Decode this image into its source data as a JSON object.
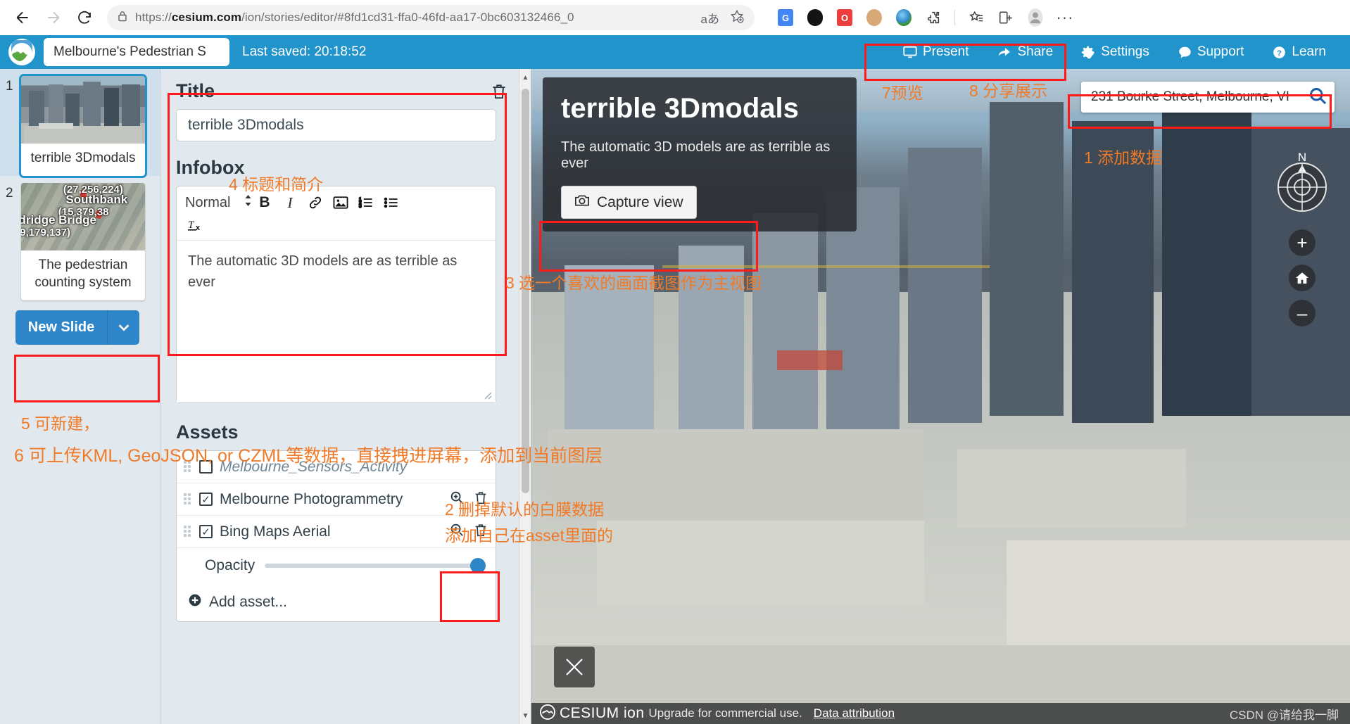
{
  "browser": {
    "back_icon": "back-arrow-icon",
    "forward_icon": "forward-arrow-icon",
    "reload_icon": "reload-icon",
    "lock_icon": "lock-icon",
    "url_prefix": "https://",
    "url_domain": "cesium.com",
    "url_path": "/ion/stories/editor/#8fd1cd31-ffa0-46fd-aa17-0bc603132466_0",
    "url_full": "https://cesium.com/ion/stories/editor/#8fd1cd31-ffa0-46fd-aa17-0bc603132466_0",
    "translate_label": "aあ",
    "favorite_icon": "add-favorite-icon",
    "extensions": [
      {
        "name": "google-translate-extension",
        "color": "#4285f4"
      },
      {
        "name": "dark-reader-extension",
        "color": "#141414"
      },
      {
        "name": "opera-extension",
        "color": "#ef3c3c"
      },
      {
        "name": "face-extension",
        "color": "#d8a877"
      },
      {
        "name": "snipaste-extension",
        "color": "#3f9f4a"
      },
      {
        "name": "puzzle-extensions-icon",
        "color": "#3c3c3c"
      }
    ],
    "collections_icon": "collections-icon",
    "favorites_icon": "favorites-list-icon",
    "split_screen_icon": "split-screen-icon",
    "profile_icon": "profile-avatar-icon",
    "more_icon": "more-options-icon"
  },
  "header": {
    "logo": "cesium-ion-logo",
    "story_title": "Melbourne's Pedestrian S",
    "last_saved": "Last saved: 20:18:52",
    "actions": [
      {
        "label": "Present",
        "icon": "monitor-icon"
      },
      {
        "label": "Share",
        "icon": "share-arrow-icon"
      },
      {
        "label": "Settings",
        "icon": "gear-icon"
      },
      {
        "label": "Support",
        "icon": "chat-bubble-icon"
      },
      {
        "label": "Learn",
        "icon": "question-circle-icon"
      }
    ]
  },
  "slides": {
    "items": [
      {
        "number": "1",
        "caption": "terrible 3Dmodals",
        "selected": true
      },
      {
        "number": "2",
        "caption": "The pedestrian counting system",
        "selected": false
      }
    ],
    "thumb2_labels": [
      "(27,256,224)",
      "Southbank",
      "(15,379,38",
      "dridge Bridge",
      "9,179,137)"
    ],
    "new_slide_label": "New Slide",
    "new_slide_caret_icon": "chevron-down-icon"
  },
  "editor": {
    "title_label": "Title",
    "title_value": "terrible 3Dmodals",
    "title_delete_icon": "trash-icon",
    "infobox_label": "Infobox",
    "rte_format": "Normal",
    "rte_format_caret": "updown-caret-icon",
    "rte_buttons": [
      {
        "name": "bold-icon",
        "glyph": "B"
      },
      {
        "name": "italic-icon",
        "glyph": "I"
      },
      {
        "name": "link-icon",
        "glyph": "🔗"
      },
      {
        "name": "image-icon",
        "glyph": "🖼"
      },
      {
        "name": "ordered-list-icon",
        "glyph": "☰"
      },
      {
        "name": "bullet-list-icon",
        "glyph": "≡"
      },
      {
        "name": "clear-format-icon",
        "glyph": "Tx"
      }
    ],
    "rte_body_text": "The automatic 3D models are as terrible as ever",
    "assets_label": "Assets",
    "assets": [
      {
        "name": "Melbourne_Sensors_Activity",
        "checked": false,
        "muted": true,
        "has_actions": false
      },
      {
        "name": "Melbourne Photogrammetry",
        "checked": true,
        "muted": false,
        "has_actions": true
      },
      {
        "name": "Bing Maps Aerial",
        "checked": true,
        "muted": false,
        "has_actions": true
      }
    ],
    "asset_zoom_icon": "zoom-to-asset-icon",
    "asset_delete_icon": "trash-icon",
    "opacity_label": "Opacity",
    "opacity_value": "100",
    "add_asset_label": "Add asset...",
    "add_asset_icon": "plus-circle-icon"
  },
  "viewer": {
    "overlay_title": "terrible 3Dmodals",
    "overlay_subtitle": "The automatic 3D models are as terrible as ever",
    "capture_view_label": "Capture view",
    "capture_view_icon": "camera-icon",
    "search_value": "231 Bourke Street, Melbourne, VI",
    "search_icon": "search-icon",
    "compass_icon": "compass-icon",
    "compass_north_label": "N",
    "zoom_in_label": "+",
    "home_icon": "home-icon",
    "zoom_out_label": "–",
    "tools_icon": "measure-tools-icon",
    "credit_brand": "CESIUM ion",
    "credit_upgrade": "Upgrade for commercial use.",
    "credit_attribution": "Data attribution",
    "watermark": "CSDN @请给我一脚"
  },
  "annotations": [
    {
      "id": "a1",
      "text": "1 添加数据"
    },
    {
      "id": "a2a",
      "text": "2 删掉默认的白膜数据"
    },
    {
      "id": "a2b",
      "text": "添加自己在asset里面的"
    },
    {
      "id": "a3",
      "text": "3 选一个喜欢的画面截图作为主视图"
    },
    {
      "id": "a4",
      "text": "4 标题和简介"
    },
    {
      "id": "a5",
      "text": "5 可新建，"
    },
    {
      "id": "a6",
      "text": "6 可上传KML, GeoJSON, or CZML等数据，直接拽进屏幕，添加到当前图层"
    },
    {
      "id": "a7",
      "text": "7预览"
    },
    {
      "id": "a8",
      "text": "8 分享展示"
    }
  ],
  "colors": {
    "cesium_blue": "#2294cc",
    "button_blue": "#2e86c8",
    "annotation_orange": "#f07a28",
    "annotation_red": "#ff1a1a",
    "panel_bg": "#e2e9ee"
  }
}
